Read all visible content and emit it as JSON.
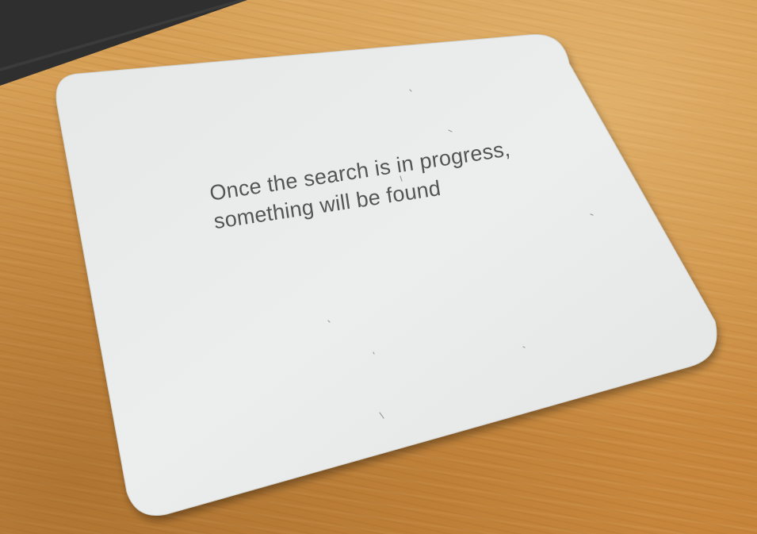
{
  "card": {
    "line1": "Once the search is in progress,",
    "line2": "something will be found"
  },
  "colors": {
    "desk": "#cf9145",
    "card": "#e8eaea",
    "text": "#555555",
    "dark_object": "#2f2f2f"
  }
}
